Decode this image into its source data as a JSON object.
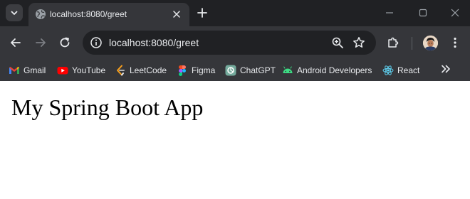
{
  "tab": {
    "title": "localhost:8080/greet"
  },
  "address_bar": {
    "url": "localhost:8080/greet"
  },
  "bookmarks": [
    {
      "label": "Gmail",
      "icon": "gmail-icon"
    },
    {
      "label": "YouTube",
      "icon": "youtube-icon"
    },
    {
      "label": "LeetCode",
      "icon": "leetcode-icon"
    },
    {
      "label": "Figma",
      "icon": "figma-icon"
    },
    {
      "label": "ChatGPT",
      "icon": "chatgpt-icon"
    },
    {
      "label": "Android Developers",
      "icon": "android-icon"
    },
    {
      "label": "React",
      "icon": "react-icon"
    }
  ],
  "page": {
    "heading": "My Spring Boot App"
  },
  "colors": {
    "tabstrip": "#202124",
    "toolbar": "#35363a",
    "omnibox": "#202124",
    "text": "#e8eaed",
    "page_background": "#ffffff"
  }
}
